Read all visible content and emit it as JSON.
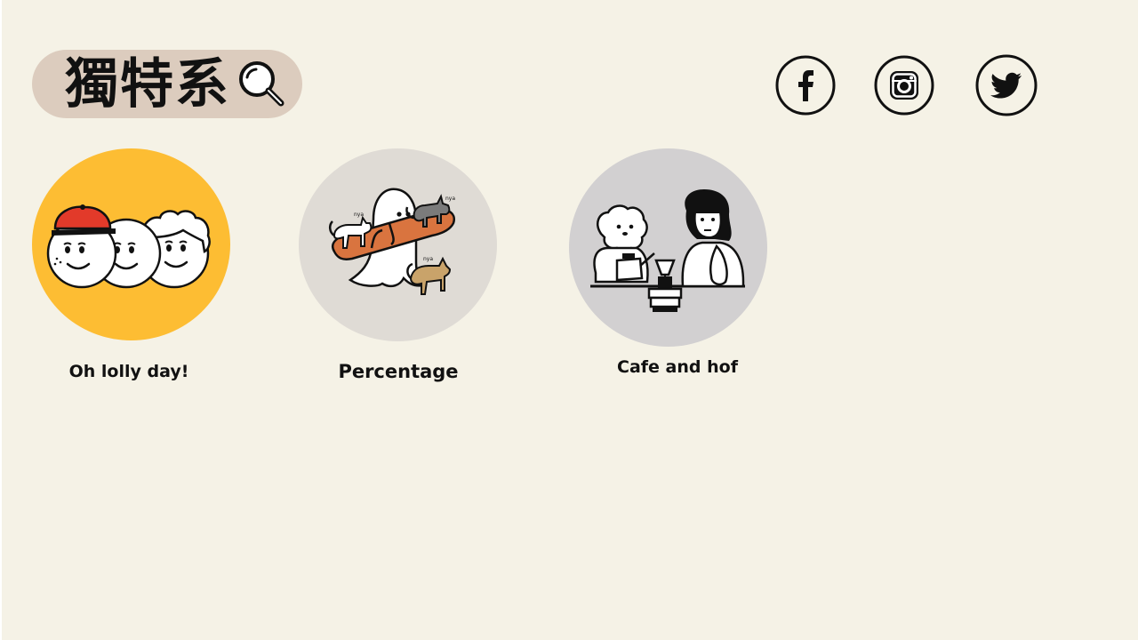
{
  "header": {
    "title": "獨特系",
    "search_icon": "search-icon"
  },
  "social": [
    {
      "name": "facebook",
      "icon": "facebook-icon"
    },
    {
      "name": "instagram",
      "icon": "instagram-icon"
    },
    {
      "name": "twitter",
      "icon": "twitter-icon"
    }
  ],
  "cards": [
    {
      "label": "Oh lolly day!",
      "bg": "#fdbd33",
      "illustration": "three-faces-illustration"
    },
    {
      "label": "Percentage",
      "bg": "#dfdbd5",
      "illustration": "ghost-bread-cats-illustration"
    },
    {
      "label": "Cafe and hof",
      "bg": "#d2d0d1",
      "illustration": "woman-dog-coffee-illustration"
    }
  ],
  "colors": {
    "page_bg": "#f5f2e6",
    "search_pill": "#dcccbe",
    "ink": "#111111",
    "accent_red": "#e23a2a",
    "accent_orange": "#d9743f",
    "accent_tan": "#c9a36a"
  }
}
